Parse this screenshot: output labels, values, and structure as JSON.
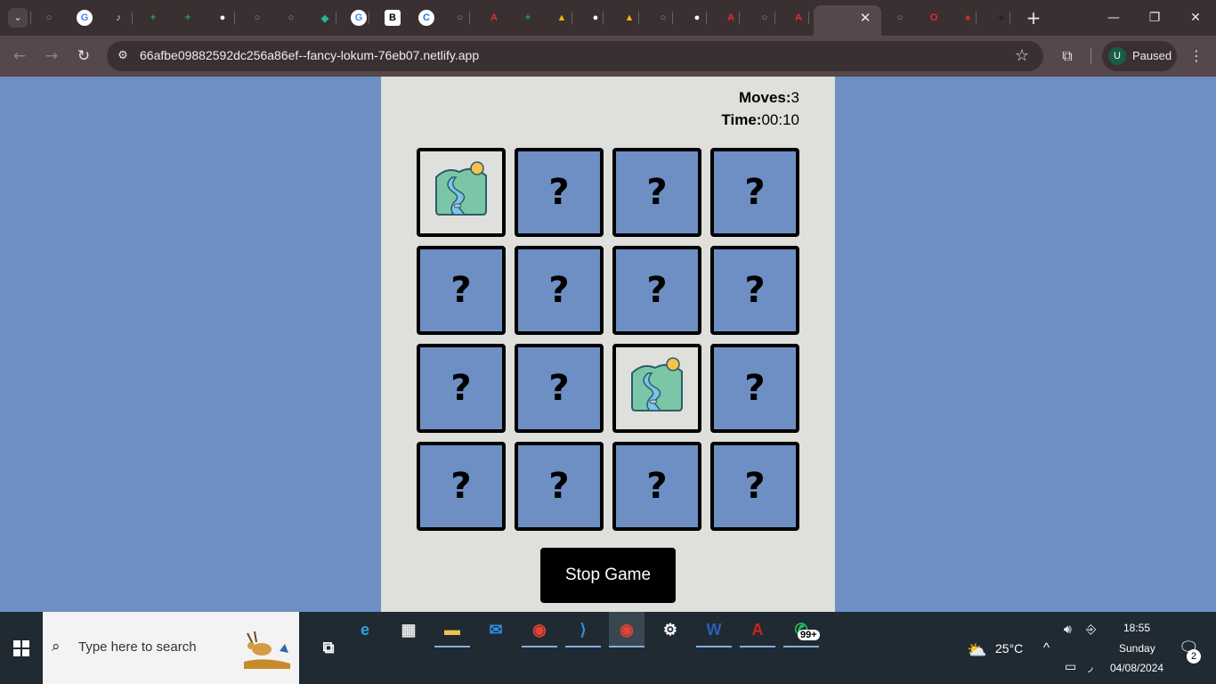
{
  "browser": {
    "tab_close": "✕",
    "new_tab": "+",
    "tabs": [
      {
        "icon": "globe-icon",
        "color": "#9a8f92",
        "glyph": "○"
      },
      {
        "icon": "google-icon",
        "color": "#ffffff",
        "glyph": "G"
      },
      {
        "icon": "music-note-icon",
        "color": "#ddd",
        "glyph": "♪"
      },
      {
        "icon": "google-sheets-icon",
        "color": "#1fa463",
        "glyph": "+"
      },
      {
        "icon": "google-sheets-icon",
        "color": "#1fa463",
        "glyph": "+"
      },
      {
        "icon": "github-icon",
        "color": "#fff",
        "glyph": "●"
      },
      {
        "icon": "globe-icon",
        "color": "#9a8f92",
        "glyph": "○"
      },
      {
        "icon": "globe-icon",
        "color": "#9a8f92",
        "glyph": "○"
      },
      {
        "icon": "diamond-icon",
        "color": "#1fb89c",
        "glyph": "◆"
      },
      {
        "icon": "google-icon",
        "color": "#ffffff",
        "glyph": "G"
      },
      {
        "icon": "b-icon",
        "color": "#000",
        "glyph": "B"
      },
      {
        "icon": "c-icon",
        "color": "#1a73e8",
        "glyph": "C"
      },
      {
        "icon": "globe-icon",
        "color": "#9a8f92",
        "glyph": "○"
      },
      {
        "icon": "adobe-icon",
        "color": "#e02d2d",
        "glyph": "A"
      },
      {
        "icon": "google-sheets-icon",
        "color": "#1fa463",
        "glyph": "+"
      },
      {
        "icon": "google-drive-icon",
        "color": "#f4b400",
        "glyph": "▲"
      },
      {
        "icon": "github-icon",
        "color": "#fff",
        "glyph": "●"
      },
      {
        "icon": "google-drive-icon",
        "color": "#f4b400",
        "glyph": "▲"
      },
      {
        "icon": "globe-icon",
        "color": "#9a8f92",
        "glyph": "○"
      },
      {
        "icon": "github-icon",
        "color": "#fff",
        "glyph": "●"
      },
      {
        "icon": "adobe-icon",
        "color": "#e02d2d",
        "glyph": "A"
      },
      {
        "icon": "globe-icon",
        "color": "#9a8f92",
        "glyph": "○"
      },
      {
        "icon": "adobe-icon",
        "color": "#e02d2d",
        "glyph": "A"
      },
      {
        "icon": "diamond-icon",
        "color": "#1fb89c",
        "glyph": "◆"
      },
      {
        "icon": "globe-icon",
        "color": "#9a8f92",
        "glyph": "○"
      },
      {
        "icon": "opera-icon",
        "color": "#e02d2d",
        "glyph": "O"
      },
      {
        "icon": "acrobat-icon",
        "color": "#e02d2d",
        "glyph": "♠"
      },
      {
        "icon": "butterfly-icon",
        "color": "#222",
        "glyph": "✦"
      }
    ],
    "url": "66afbe09882592dc256a86ef--fancy-lokum-76eb07.netlify.app",
    "profile_initial": "U",
    "profile_status": "Paused"
  },
  "game": {
    "moves_label": "Moves:",
    "moves_value": "3",
    "time_label": "Time:",
    "time_value": "00:10",
    "hidden_glyph": "?",
    "cards": [
      {
        "state": "revealed",
        "image": "river-landscape-icon"
      },
      {
        "state": "hidden"
      },
      {
        "state": "hidden"
      },
      {
        "state": "hidden"
      },
      {
        "state": "hidden"
      },
      {
        "state": "hidden"
      },
      {
        "state": "hidden"
      },
      {
        "state": "hidden"
      },
      {
        "state": "hidden"
      },
      {
        "state": "hidden"
      },
      {
        "state": "revealed",
        "image": "river-landscape-icon"
      },
      {
        "state": "hidden"
      },
      {
        "state": "hidden"
      },
      {
        "state": "hidden"
      },
      {
        "state": "hidden"
      },
      {
        "state": "hidden"
      }
    ],
    "stop_button": "Stop Game"
  },
  "taskbar": {
    "search_placeholder": "Type here to search",
    "weather": "25°C",
    "time": "18:55",
    "day": "Sunday",
    "date": "04/08/2024",
    "whatsapp_badge": "99+",
    "notification_count": "2",
    "apps": [
      {
        "name": "edge-icon",
        "glyph": "e",
        "color": "#2fa0e0"
      },
      {
        "name": "store-icon",
        "glyph": "▦",
        "color": "#e8e8e8"
      },
      {
        "name": "file-explorer-icon",
        "glyph": "▬",
        "color": "#f2c14e"
      },
      {
        "name": "mail-icon",
        "glyph": "✉",
        "color": "#2f8fe0"
      },
      {
        "name": "chrome-icon",
        "glyph": "◉",
        "color": "#e94235"
      },
      {
        "name": "vscode-icon",
        "glyph": "⟩",
        "color": "#2f8fe0"
      },
      {
        "name": "chrome-icon",
        "glyph": "◉",
        "color": "#e94235"
      },
      {
        "name": "settings-icon",
        "glyph": "⚙",
        "color": "#ffffff"
      },
      {
        "name": "word-icon",
        "glyph": "W",
        "color": "#2b5fb3"
      },
      {
        "name": "acrobat-icon",
        "glyph": "A",
        "color": "#d21f1f"
      },
      {
        "name": "whatsapp-icon",
        "glyph": "✆",
        "color": "#27c35b"
      }
    ]
  }
}
